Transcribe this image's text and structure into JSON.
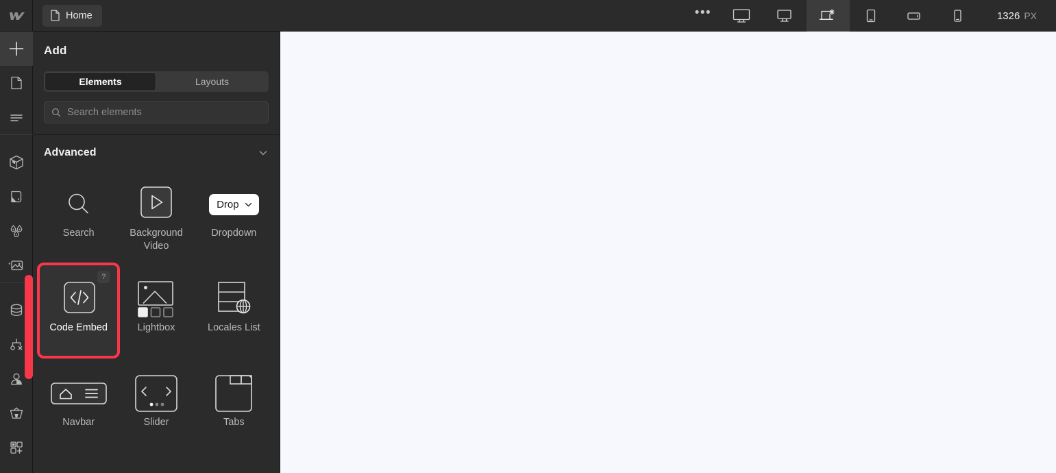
{
  "topbar": {
    "logo_icon": "webflow-logo",
    "page_tab": {
      "label": "Home",
      "icon": "page-icon"
    },
    "more_label": "•••",
    "breakpoints": [
      {
        "name": "desktop-large",
        "icon": "monitor-icon",
        "active": false
      },
      {
        "name": "desktop",
        "icon": "monitor-small-icon",
        "active": false
      },
      {
        "name": "base",
        "icon": "laptop-base-icon",
        "active": true
      },
      {
        "name": "tablet",
        "icon": "tablet-icon",
        "active": false
      },
      {
        "name": "mobile-landscape",
        "icon": "mobile-landscape-icon",
        "active": false
      },
      {
        "name": "mobile-portrait",
        "icon": "mobile-portrait-icon",
        "active": false
      }
    ],
    "viewport_width": "1326",
    "viewport_unit": "PX"
  },
  "rail": {
    "items": [
      {
        "name": "add-elements",
        "icon": "plus-icon",
        "active": true
      },
      {
        "name": "pages",
        "icon": "page-icon",
        "active": false
      },
      {
        "name": "navigator",
        "icon": "layers-icon",
        "active": false
      },
      {
        "name": "components",
        "icon": "cube-icon",
        "active": false
      },
      {
        "name": "style-selectors",
        "icon": "paint-swatch-icon",
        "active": false
      },
      {
        "name": "variables",
        "icon": "droplets-icon",
        "active": false
      },
      {
        "name": "assets",
        "icon": "image-icon",
        "active": false
      },
      {
        "name": "cms",
        "icon": "database-icon",
        "active": false
      },
      {
        "name": "logic",
        "icon": "logic-flow-icon",
        "active": false
      },
      {
        "name": "users",
        "icon": "user-icon",
        "active": false
      },
      {
        "name": "ecommerce",
        "icon": "basket-icon",
        "active": false
      },
      {
        "name": "apps",
        "icon": "apps-grid-icon",
        "active": false
      }
    ]
  },
  "panel": {
    "title": "Add",
    "tabs": [
      {
        "label": "Elements",
        "active": true
      },
      {
        "label": "Layouts",
        "active": false
      }
    ],
    "search": {
      "value": "",
      "placeholder": "Search elements",
      "icon": "search-icon"
    },
    "section": {
      "title": "Advanced",
      "collapse_icon": "chevron-down-icon",
      "expanded": true,
      "tiles": [
        {
          "label": "Search",
          "icon": "search-glyph",
          "selected": false,
          "help": false
        },
        {
          "label": "Background Video",
          "icon": "play-in-box-glyph",
          "selected": false,
          "help": false
        },
        {
          "label": "Dropdown",
          "icon": "dropdown-pill-glyph",
          "pill_text": "Drop",
          "selected": false,
          "help": false
        },
        {
          "label": "Code Embed",
          "icon": "code-brackets-glyph",
          "selected": true,
          "help": true,
          "help_label": "?"
        },
        {
          "label": "Lightbox",
          "icon": "lightbox-glyph",
          "selected": false,
          "help": false
        },
        {
          "label": "Locales List",
          "icon": "locales-globe-glyph",
          "selected": false,
          "help": false
        },
        {
          "label": "Navbar",
          "icon": "navbar-glyph",
          "selected": false,
          "help": false
        },
        {
          "label": "Slider",
          "icon": "slider-glyph",
          "selected": false,
          "help": false
        },
        {
          "label": "Tabs",
          "icon": "tabs-glyph",
          "selected": false,
          "help": false
        }
      ]
    }
  },
  "colors": {
    "accent_highlight": "#f8374a",
    "panel_bg": "#2b2b2b",
    "canvas_bg": "#f7f8fd"
  }
}
